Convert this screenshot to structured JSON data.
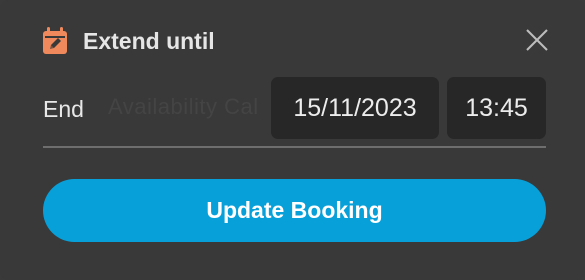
{
  "dialog": {
    "title": "Extend until",
    "background_text": "Availability Cal",
    "end_label": "End",
    "date_value": "15/11/2023",
    "time_value": "13:45",
    "update_button_label": "Update Booking",
    "icons": {
      "title_icon": "calendar-edit-icon",
      "close_icon": "close-icon"
    },
    "colors": {
      "accent_button": "#08a0d9",
      "title_icon": "#f08a5d",
      "background": "#393939",
      "field_background": "#272727"
    }
  }
}
